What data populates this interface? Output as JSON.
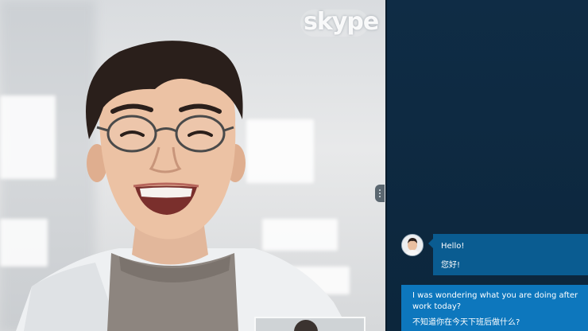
{
  "app": {
    "logo_text": "skype"
  },
  "chat": {
    "messages": [
      {
        "direction": "incoming",
        "text": "Hello!",
        "translation": "您好!"
      },
      {
        "direction": "outgoing",
        "text": "I was wondering what you are doing after work today?",
        "translation": "不知道你在今天下班后做什么?"
      }
    ]
  },
  "colors": {
    "chat_background": "#0f2c45",
    "incoming_bubble": "#0a5c91",
    "outgoing_bubble": "#0d77bd"
  }
}
